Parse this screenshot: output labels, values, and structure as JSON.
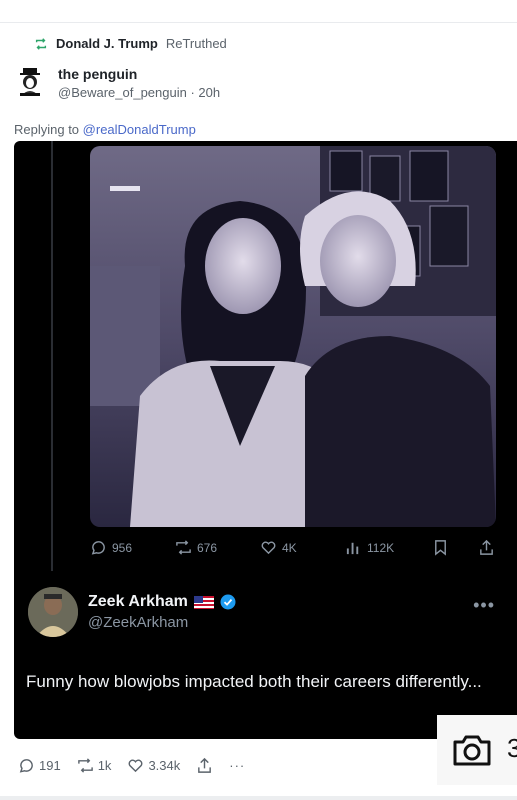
{
  "retruth": {
    "name": "Donald J. Trump",
    "verb": "ReTruthed"
  },
  "author": {
    "display_name": "the penguin",
    "handle": "@Beware_of_penguin",
    "age": "20h"
  },
  "replying": {
    "prefix": "Replying to",
    "mention": "@realDonaldTrump"
  },
  "embedded_post": {
    "stats": {
      "replies": "956",
      "reposts": "676",
      "likes": "4K",
      "views": "112K"
    },
    "quote_user": {
      "name": "Zeek Arkham",
      "handle": "@ZeekArkham"
    },
    "text": "Funny how blowjobs impacted both their careers differently..."
  },
  "post_stats": {
    "replies": "191",
    "retruths": "1k",
    "likes": "3.34k"
  },
  "overlay": {
    "camera_count": "3"
  },
  "colors": {
    "retruth_green": "#2ea46a",
    "link_blue": "#4a69c9",
    "verified_blue": "#1d9bf0"
  }
}
